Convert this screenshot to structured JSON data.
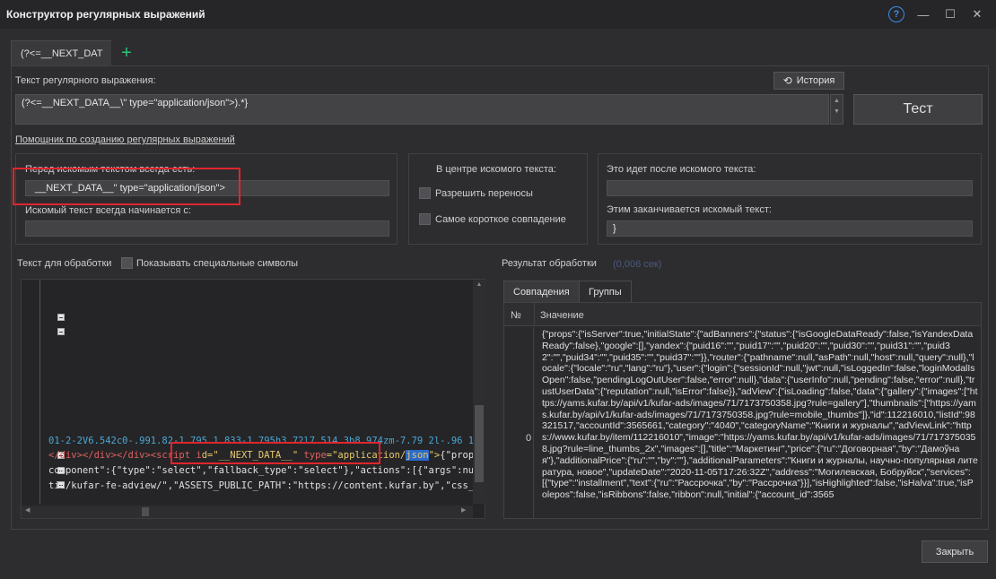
{
  "window": {
    "title": "Конструктор регулярных выражений",
    "help_glyph": "?",
    "min_glyph": "—",
    "max_glyph": "☐",
    "close_glyph": "✕"
  },
  "tabs": [
    {
      "label": "(?<=__NEXT_DAT"
    }
  ],
  "add_tab_glyph": "+",
  "regex": {
    "label": "Текст регулярного выражения:",
    "value": "(?<=__NEXT_DATA__\\\" type=\"application/json\">).*}",
    "history_button": "История",
    "test_button": "Тест"
  },
  "helper_link": "Помощник по созданию регулярных выражений",
  "before": {
    "label": "Перед искомым текстом всегда есть:",
    "value": "__NEXT_DATA__\" type=\"application/json\">",
    "starts_label": "Искомый текст всегда начинается с:",
    "starts_value": ""
  },
  "center": {
    "label": "В центре искомого текста:",
    "allow_wrap": "Разрешить переносы",
    "shortest": "Самое короткое совпадение"
  },
  "after": {
    "label": "Это идет после искомого текста:",
    "value": "",
    "ends_label": "Этим заканчивается искомый текст:",
    "ends_value": "}"
  },
  "source": {
    "label": "Текст для обработки",
    "show_special": "Показывать специальные символы",
    "lines": {
      "svg_path": "01-2-2V6.542c0-.991.82-1.795 1.833-1.795h3.72l7.514 3b8.974zm-7.79 2l-.96 1.747H3V19h18V",
      "tag_pre": "</div></div></div><script i",
      "tag_id": "d=\"__NEXT_DATA__\" ",
      "tag_type_attr": "type",
      "tag_type_val": "=\"application/",
      "tag_json": "json",
      "tag_end": "\">",
      "tag_rest": "{\"props\":{\"isServer\":tr",
      "component": "component\":{\"type\":\"select\",\"fallback_type\":\"select\"},\"actions\":[{\"args\":null,\"name\":\"v_area\",\"type",
      "assets": "tic/kufar-fe-adview/\",\"ASSETS_PUBLIC_PATH\":\"https://content.kufar.by\",\"css_prefix\":\"kfa\",\"cooki"
    }
  },
  "result": {
    "label": "Результат обработки",
    "time": "(0,006 сек)",
    "tab_matches": "Совпадения",
    "tab_groups": "Группы",
    "col_no": "№",
    "col_value": "Значение",
    "row_no": "0",
    "row_value": "{\"props\":{\"isServer\":true,\"initialState\":{\"adBanners\":{\"status\":{\"isGoogleDataReady\":false,\"isYandexDataReady\":false},\"google\":[],\"yandex\":{\"puid16\":\"\",\"puid17\":\"\",\"puid20\":\"\",\"puid30\":\"\",\"puid31\":\"\",\"puid32\":\"\",\"puid34\":\"\",\"puid35\":\"\",\"puid37\":\"\"}},\"router\":{\"pathname\":null,\"asPath\":null,\"host\":null,\"query\":null},\"locale\":{\"locale\":\"ru\",\"lang\":\"ru\"},\"user\":{\"login\":{\"sessionId\":null,\"jwt\":null,\"isLoggedIn\":false,\"loginModalIsOpen\":false,\"pendingLogOutUser\":false,\"error\":null},\"data\":{\"userInfo\":null,\"pending\":false,\"error\":null},\"trustUserData\":{\"reputation\":null,\"isError\":false}},\"adView\":{\"isLoading\":false,\"data\":{\"gallery\":{\"images\":[\"https://yams.kufar.by/api/v1/kufar-ads/images/71/7173750358.jpg?rule=gallery\"],\"thumbnails\":[\"https://yams.kufar.by/api/v1/kufar-ads/images/71/7173750358.jpg?rule=mobile_thumbs\"]},\"id\":112216010,\"listId\":98321517,\"accountId\":3565661,\"category\":\"4040\",\"categoryName\":\"Книги и журналы\",\"adViewLink\":\"https://www.kufar.by/item/112216010\",\"image\":\"https://yams.kufar.by/api/v1/kufar-ads/images/71/7173750358.jpg?rule=line_thumbs_2x\",\"images\":[],\"title\":\"Маркетинг\",\"price\":{\"ru\":\"Договорная\",\"by\":\"Дамоўная\"},\"additionalPrice\":{\"ru\":\"\",\"by\":\"\"},\"additionalParameters\":\"Книги и журналы, научно-популярная литература, новое\",\"updateDate\":\"2020-11-05T17:26:32Z\",\"address\":\"Могилевская, Бобруйск\",\"services\":[{\"type\":\"installment\",\"text\":{\"ru\":\"Рассрочка\",\"by\":\"Рассрочка\"}}],\"isHighlighted\":false,\"isHalva\":true,\"isPolepos\":false,\"isRibbons\":false,\"ribbon\":null,\"initial\":{\"account_id\":3565"
  },
  "close_button": "Закрыть",
  "colors": {
    "background": "#2d2d30",
    "highlight_red": "#e0252c",
    "accent_blue": "#3c8ce6",
    "add_green": "#2fc47a"
  }
}
